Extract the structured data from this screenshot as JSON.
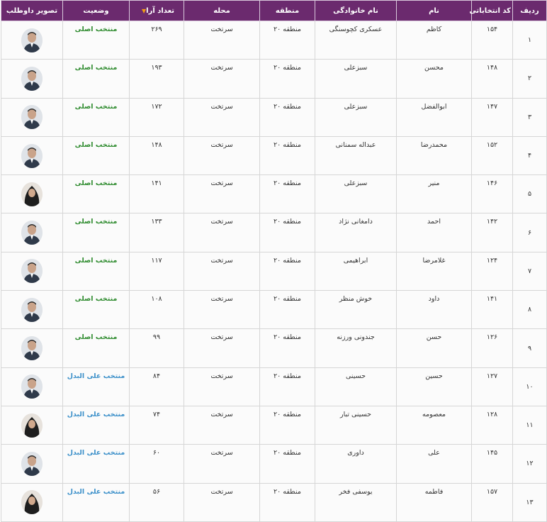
{
  "headers": {
    "row": "ردیف",
    "code": "کد انتخاباتی",
    "first_name": "نام",
    "last_name": "نام خانوادگی",
    "district": "منطقه",
    "neighborhood": "محله",
    "votes": "تعداد آرا",
    "status": "وضعیت",
    "photo": "تصویر داوطلب"
  },
  "sort_indicator": "▼",
  "rows": [
    {
      "row": "۱",
      "code": "۱۵۴",
      "first_name": "کاظم",
      "last_name": "عسکری کچوسنگی",
      "district": "منطقه ۲۰",
      "neighborhood": "سرتخت",
      "votes": "۲۶۹",
      "status": "منتخب اصلی",
      "status_type": "main",
      "avatar": "man-icon"
    },
    {
      "row": "۲",
      "code": "۱۴۸",
      "first_name": "محسن",
      "last_name": "سبزعلی",
      "district": "منطقه ۲۰",
      "neighborhood": "سرتخت",
      "votes": "۱۹۳",
      "status": "منتخب اصلی",
      "status_type": "main",
      "avatar": "man-icon"
    },
    {
      "row": "۳",
      "code": "۱۴۷",
      "first_name": "ابوالفضل",
      "last_name": "سبزعلی",
      "district": "منطقه ۲۰",
      "neighborhood": "سرتخت",
      "votes": "۱۷۲",
      "status": "منتخب اصلی",
      "status_type": "main",
      "avatar": "man-icon"
    },
    {
      "row": "۴",
      "code": "۱۵۲",
      "first_name": "محمدرضا",
      "last_name": "عبداله سمنانی",
      "district": "منطقه ۲۰",
      "neighborhood": "سرتخت",
      "votes": "۱۴۸",
      "status": "منتخب اصلی",
      "status_type": "main",
      "avatar": "man-icon"
    },
    {
      "row": "۵",
      "code": "۱۴۶",
      "first_name": "منیر",
      "last_name": "سبزعلی",
      "district": "منطقه ۲۰",
      "neighborhood": "سرتخت",
      "votes": "۱۴۱",
      "status": "منتخب اصلی",
      "status_type": "main",
      "avatar": "woman-icon"
    },
    {
      "row": "۶",
      "code": "۱۴۲",
      "first_name": "احمد",
      "last_name": "دامغانی نژاد",
      "district": "منطقه ۲۰",
      "neighborhood": "سرتخت",
      "votes": "۱۳۳",
      "status": "منتخب اصلی",
      "status_type": "main",
      "avatar": "man-icon"
    },
    {
      "row": "۷",
      "code": "۱۲۴",
      "first_name": "غلامرضا",
      "last_name": "ابراهیمی",
      "district": "منطقه ۲۰",
      "neighborhood": "سرتخت",
      "votes": "۱۱۷",
      "status": "منتخب اصلی",
      "status_type": "main",
      "avatar": "man-icon"
    },
    {
      "row": "۸",
      "code": "۱۴۱",
      "first_name": "داود",
      "last_name": "خوش منظر",
      "district": "منطقه ۲۰",
      "neighborhood": "سرتخت",
      "votes": "۱۰۸",
      "status": "منتخب اصلی",
      "status_type": "main",
      "avatar": "man-icon"
    },
    {
      "row": "۹",
      "code": "۱۲۶",
      "first_name": "حسن",
      "last_name": "جندونی ورزنه",
      "district": "منطقه ۲۰",
      "neighborhood": "سرتخت",
      "votes": "۹۹",
      "status": "منتخب اصلی",
      "status_type": "main",
      "avatar": "man-icon"
    },
    {
      "row": "۱۰",
      "code": "۱۲۷",
      "first_name": "حسین",
      "last_name": "حسینی",
      "district": "منطقه ۲۰",
      "neighborhood": "سرتخت",
      "votes": "۸۴",
      "status": "منتخب علی البدل",
      "status_type": "alt",
      "avatar": "man-icon"
    },
    {
      "row": "۱۱",
      "code": "۱۲۸",
      "first_name": "معصومه",
      "last_name": "حسینی تبار",
      "district": "منطقه ۲۰",
      "neighborhood": "سرتخت",
      "votes": "۷۴",
      "status": "منتخب علی البدل",
      "status_type": "alt",
      "avatar": "woman-icon"
    },
    {
      "row": "۱۲",
      "code": "۱۴۵",
      "first_name": "علی",
      "last_name": "داوری",
      "district": "منطقه ۲۰",
      "neighborhood": "سرتخت",
      "votes": "۶۰",
      "status": "منتخب علی البدل",
      "status_type": "alt",
      "avatar": "man-icon"
    },
    {
      "row": "۱۳",
      "code": "۱۵۷",
      "first_name": "فاطمه",
      "last_name": "یوسفی فخر",
      "district": "منطقه ۲۰",
      "neighborhood": "سرتخت",
      "votes": "۵۶",
      "status": "منتخب علی البدل",
      "status_type": "alt",
      "avatar": "woman-icon"
    }
  ],
  "colors": {
    "header_bg": "#6b2a6e",
    "status_main": "#2e8b2e",
    "status_alt": "#3a8fc9",
    "sort_arrow": "#f39c12"
  }
}
